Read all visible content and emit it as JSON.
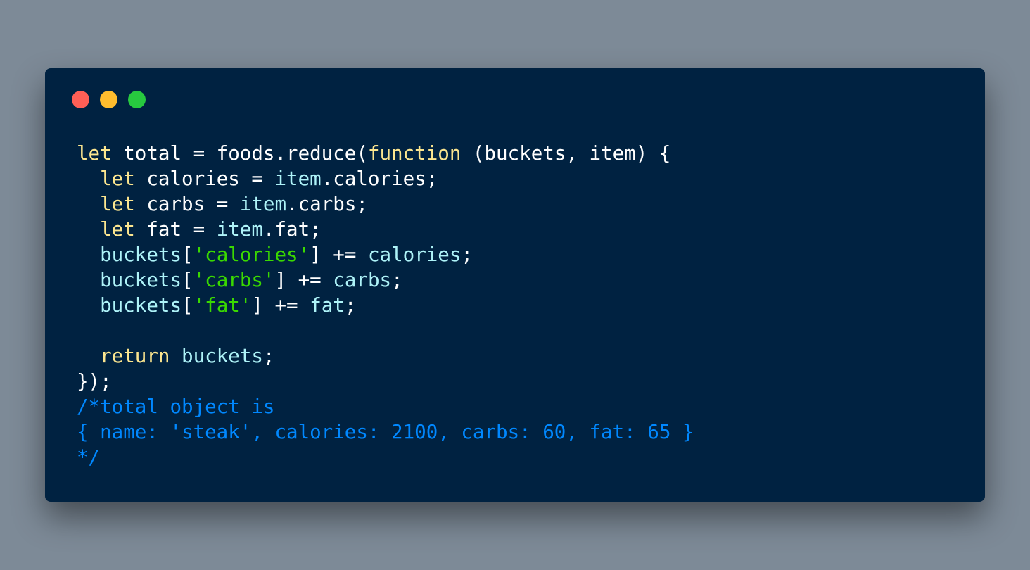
{
  "window": {
    "controls": [
      {
        "name": "close-button",
        "color": "#ff5f56"
      },
      {
        "name": "minimize-button",
        "color": "#ffbd2e"
      },
      {
        "name": "zoom-button",
        "color": "#27c93f"
      }
    ]
  },
  "colors": {
    "background": "#7d8a97",
    "editor": "#002241",
    "keyword": "#fce68f",
    "variable": "#aef3f8",
    "string": "#3ad900",
    "comment": "#0088ff",
    "plain": "#ffffff"
  },
  "code": {
    "lines": [
      [
        {
          "t": "let",
          "k": "kw"
        },
        {
          "t": " total = foods.reduce(",
          "k": "pl"
        },
        {
          "t": "function",
          "k": "kw"
        },
        {
          "t": " (buckets, item) {",
          "k": "pl"
        }
      ],
      [
        {
          "t": "  ",
          "k": "pl"
        },
        {
          "t": "let",
          "k": "kw"
        },
        {
          "t": " calories = ",
          "k": "pl"
        },
        {
          "t": "item",
          "k": "var"
        },
        {
          "t": ".calories;",
          "k": "pl"
        }
      ],
      [
        {
          "t": "  ",
          "k": "pl"
        },
        {
          "t": "let",
          "k": "kw"
        },
        {
          "t": " carbs = ",
          "k": "pl"
        },
        {
          "t": "item",
          "k": "var"
        },
        {
          "t": ".carbs;",
          "k": "pl"
        }
      ],
      [
        {
          "t": "  ",
          "k": "pl"
        },
        {
          "t": "let",
          "k": "kw"
        },
        {
          "t": " fat = ",
          "k": "pl"
        },
        {
          "t": "item",
          "k": "var"
        },
        {
          "t": ".fat;",
          "k": "pl"
        }
      ],
      [
        {
          "t": "  ",
          "k": "pl"
        },
        {
          "t": "buckets",
          "k": "var"
        },
        {
          "t": "[",
          "k": "pl"
        },
        {
          "t": "'calories'",
          "k": "str"
        },
        {
          "t": "] += ",
          "k": "pl"
        },
        {
          "t": "calories",
          "k": "var"
        },
        {
          "t": ";",
          "k": "pl"
        }
      ],
      [
        {
          "t": "  ",
          "k": "pl"
        },
        {
          "t": "buckets",
          "k": "var"
        },
        {
          "t": "[",
          "k": "pl"
        },
        {
          "t": "'carbs'",
          "k": "str"
        },
        {
          "t": "] += ",
          "k": "pl"
        },
        {
          "t": "carbs",
          "k": "var"
        },
        {
          "t": ";",
          "k": "pl"
        }
      ],
      [
        {
          "t": "  ",
          "k": "pl"
        },
        {
          "t": "buckets",
          "k": "var"
        },
        {
          "t": "[",
          "k": "pl"
        },
        {
          "t": "'fat'",
          "k": "str"
        },
        {
          "t": "] += ",
          "k": "pl"
        },
        {
          "t": "fat",
          "k": "var"
        },
        {
          "t": ";",
          "k": "pl"
        }
      ],
      [],
      [
        {
          "t": "  ",
          "k": "pl"
        },
        {
          "t": "return",
          "k": "kw"
        },
        {
          "t": " ",
          "k": "pl"
        },
        {
          "t": "buckets",
          "k": "var"
        },
        {
          "t": ";",
          "k": "pl"
        }
      ],
      [
        {
          "t": "});",
          "k": "pl"
        }
      ],
      [
        {
          "t": "/*total object is",
          "k": "cmt"
        }
      ],
      [
        {
          "t": "{ name: 'steak', calories: 2100, carbs: 60, fat: 65 }",
          "k": "cmt"
        }
      ],
      [
        {
          "t": "*/",
          "k": "cmt"
        }
      ]
    ]
  }
}
